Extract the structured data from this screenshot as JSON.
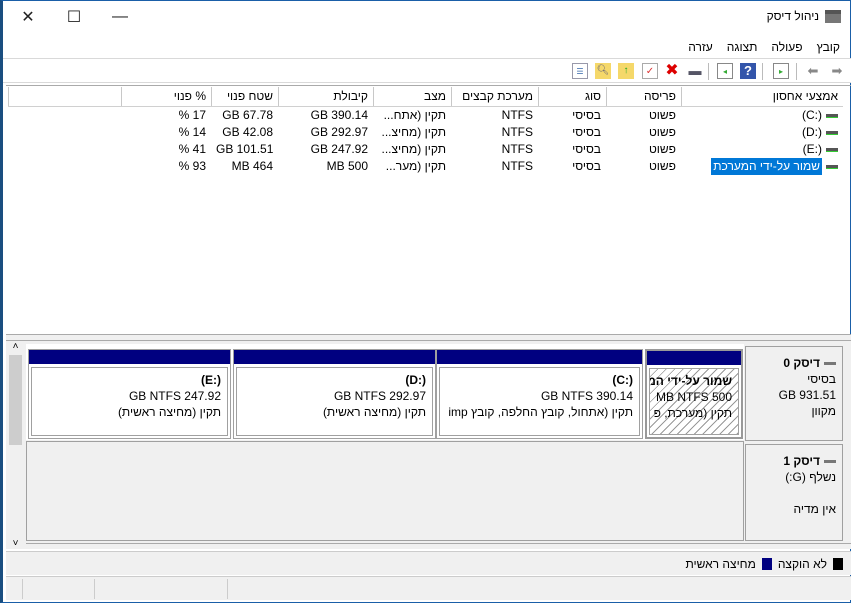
{
  "window": {
    "title": "ניהול דיסק",
    "minimize": "—",
    "maximize": "☐",
    "close": "✕"
  },
  "menu": [
    "קובץ",
    "פעולה",
    "תצוגה",
    "עזרה"
  ],
  "table": {
    "headers": [
      "אמצעי אחסון",
      "פריסה",
      "סוג",
      "מערכת קבצים",
      "מצב",
      "קיבולת",
      "שטח פנוי",
      "% פנוי"
    ],
    "rows": [
      [
        "(C:)",
        "פשוט",
        "בסיסי",
        "NTFS",
        "תקין (אתח...",
        "GB 390.14",
        "GB 67.78",
        "% 17"
      ],
      [
        "(D:)",
        "פשוט",
        "בסיסי",
        "NTFS",
        "תקין (מחיצ...",
        "GB 292.97",
        "GB 42.08",
        "% 14"
      ],
      [
        "(E:)",
        "פשוט",
        "בסיסי",
        "NTFS",
        "תקין (מחיצ...",
        "GB 247.92",
        "GB 101.51",
        "% 41"
      ],
      [
        "שמור על-ידי המערכת",
        "פשוט",
        "בסיסי",
        "NTFS",
        "תקין (מער...",
        "MB 500",
        "MB 464",
        "% 93"
      ]
    ]
  },
  "disks": [
    {
      "name": "דיסק 0",
      "type": "בסיסי",
      "size": "GB 931.51",
      "state": "מקוון",
      "partitions": [
        {
          "name": "שמור על-ידי המ",
          "size": "MB NTFS 500",
          "status": "תקין (מערכת, פ"
        },
        {
          "name": "(C:)",
          "size": "GB NTFS 390.14",
          "status": "תקין (אתחול, קובץ החלפה, קובץ imp"
        },
        {
          "name": "(D:)",
          "size": "GB NTFS 292.97",
          "status": "תקין (מחיצה ראשית)"
        },
        {
          "name": "(E:)",
          "size": "GB NTFS 247.92",
          "status": "תקין (מחיצה ראשית)"
        }
      ]
    },
    {
      "name": "דיסק 1",
      "type": "נשלף (G:)",
      "state": "אין מדיה"
    }
  ],
  "legend": [
    {
      "label": "לא הוקצה",
      "color": "#000000"
    },
    {
      "label": "מחיצה ראשית",
      "color": "#000080"
    }
  ],
  "colors": {
    "selection": "#0078d7",
    "partition_bar": "#000080"
  }
}
